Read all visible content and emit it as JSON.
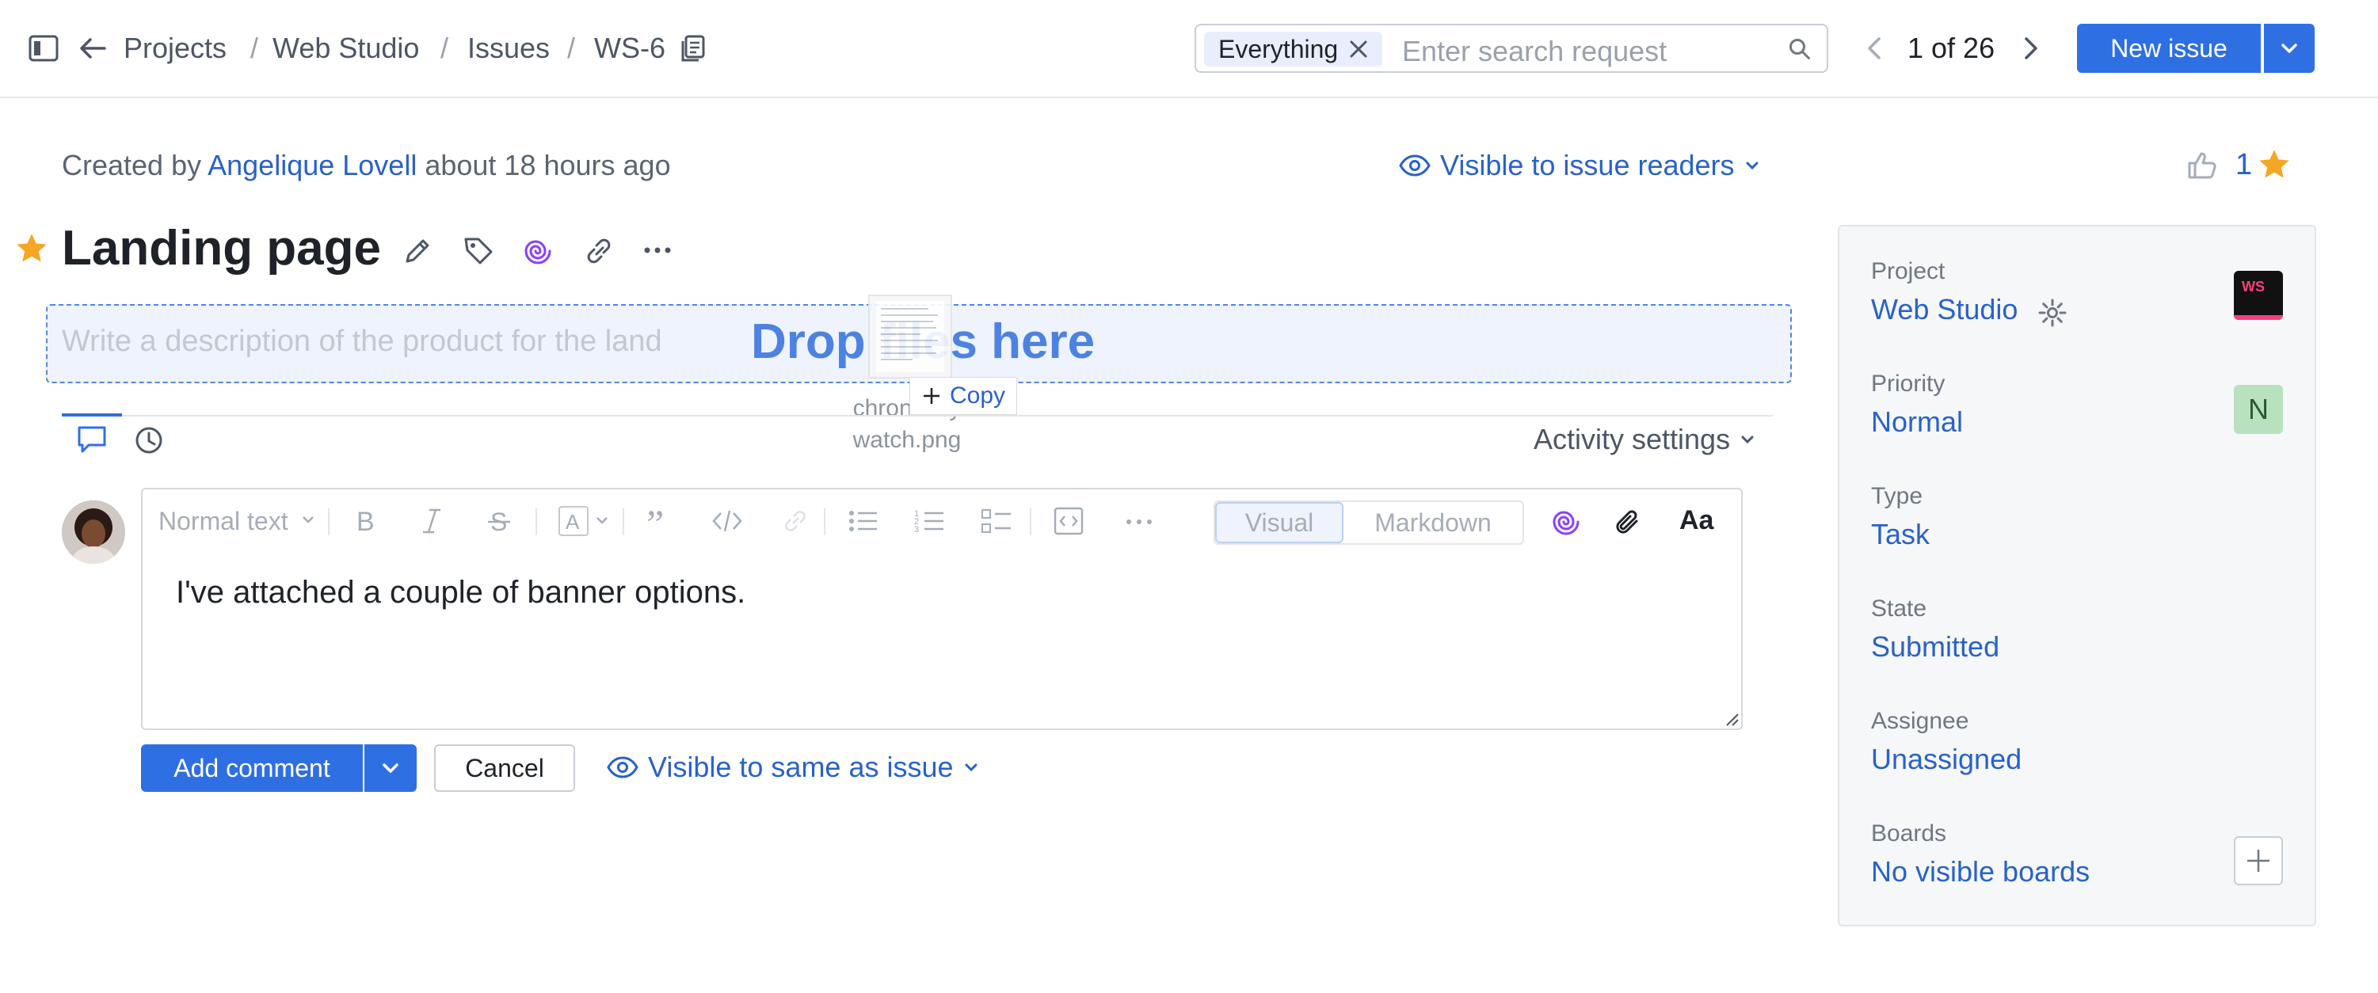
{
  "header": {
    "breadcrumb": [
      "Projects",
      "Web Studio",
      "Issues",
      "WS-6"
    ],
    "search": {
      "chip_label": "Everything",
      "placeholder": "Enter search request"
    },
    "pager": "1 of 26",
    "new_issue_label": "New issue"
  },
  "issue": {
    "meta": {
      "prefix": "Created by",
      "author": "Angelique Lovell",
      "time": "about 18 hours ago"
    },
    "visibility": "Visible to issue readers",
    "title": "Landing page",
    "description_placeholder": "Write a description of the product for the land",
    "drop_text": "Drop files here",
    "drag": {
      "file_name_line1": "chrono…y",
      "file_name_line2": "watch.png",
      "copy_label": "Copy"
    }
  },
  "activity": {
    "settings_label": "Activity settings",
    "editor": {
      "style_select": "Normal text",
      "mode_visual": "Visual",
      "mode_markdown": "Markdown",
      "font_toggle": "Aa",
      "text": "I've attached a couple of banner options."
    },
    "add_comment_label": "Add comment",
    "cancel_label": "Cancel",
    "comment_visibility": "Visible to same as issue"
  },
  "sidebar": {
    "star_count": "1",
    "project_logo_text": "WS",
    "assignee_initial": "N",
    "fields": [
      {
        "label": "Project",
        "value": "Web Studio"
      },
      {
        "label": "Priority",
        "value": "Normal"
      },
      {
        "label": "Type",
        "value": "Task"
      },
      {
        "label": "State",
        "value": "Submitted"
      },
      {
        "label": "Assignee",
        "value": "Unassigned"
      },
      {
        "label": "Boards",
        "value": "No visible boards"
      }
    ]
  },
  "colors": {
    "accent": "#2f6fe4",
    "link": "#2862c8",
    "star": "#f5a623",
    "ai": "#8a3ffc"
  }
}
